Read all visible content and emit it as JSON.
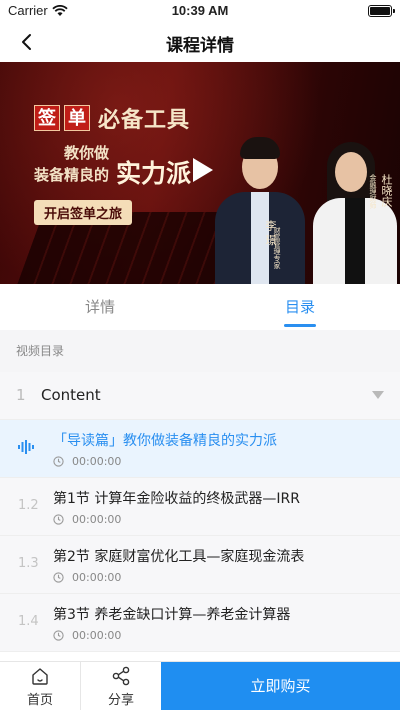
{
  "status_bar": {
    "carrier": "Carrier",
    "time": "10:39 AM"
  },
  "nav": {
    "title": "课程详情"
  },
  "banner": {
    "tag_chars": [
      "签",
      "单"
    ],
    "headline_rest": "必备工具",
    "line1": "教你做",
    "line2": "装备精良的",
    "line3": "实力派",
    "button": "开启签单之旅",
    "presenter_male_name": "李 璟",
    "presenter_male_title": "财富管理专家",
    "presenter_female_name": "杜晓庆",
    "presenter_female_title": "金融理财师"
  },
  "tabs": {
    "details": "详情",
    "catalog": "目录",
    "active": "catalog"
  },
  "catalog": {
    "header": "视频目录",
    "chapter": {
      "index": "1",
      "title": "Content"
    },
    "lessons": [
      {
        "index": "",
        "title": "「导读篇」教你做装备精良的实力派",
        "duration": "00:00:00",
        "active": true,
        "icon": "audio-playing-icon"
      },
      {
        "index": "1.2",
        "title": "第1节 计算年金险收益的终极武器—IRR",
        "duration": "00:00:00",
        "active": false
      },
      {
        "index": "1.3",
        "title": "第2节 家庭财富优化工具—家庭现金流表",
        "duration": "00:00:00",
        "active": false
      },
      {
        "index": "1.4",
        "title": "第3节 养老金缺口计算—养老金计算器",
        "duration": "00:00:00",
        "active": false
      }
    ]
  },
  "bottom_bar": {
    "home": "首页",
    "share": "分享",
    "buy": "立即购买"
  },
  "colors": {
    "accent": "#1f8ef1",
    "active_row_bg": "#eaf4fe",
    "banner_red": "#5b0d0c"
  }
}
